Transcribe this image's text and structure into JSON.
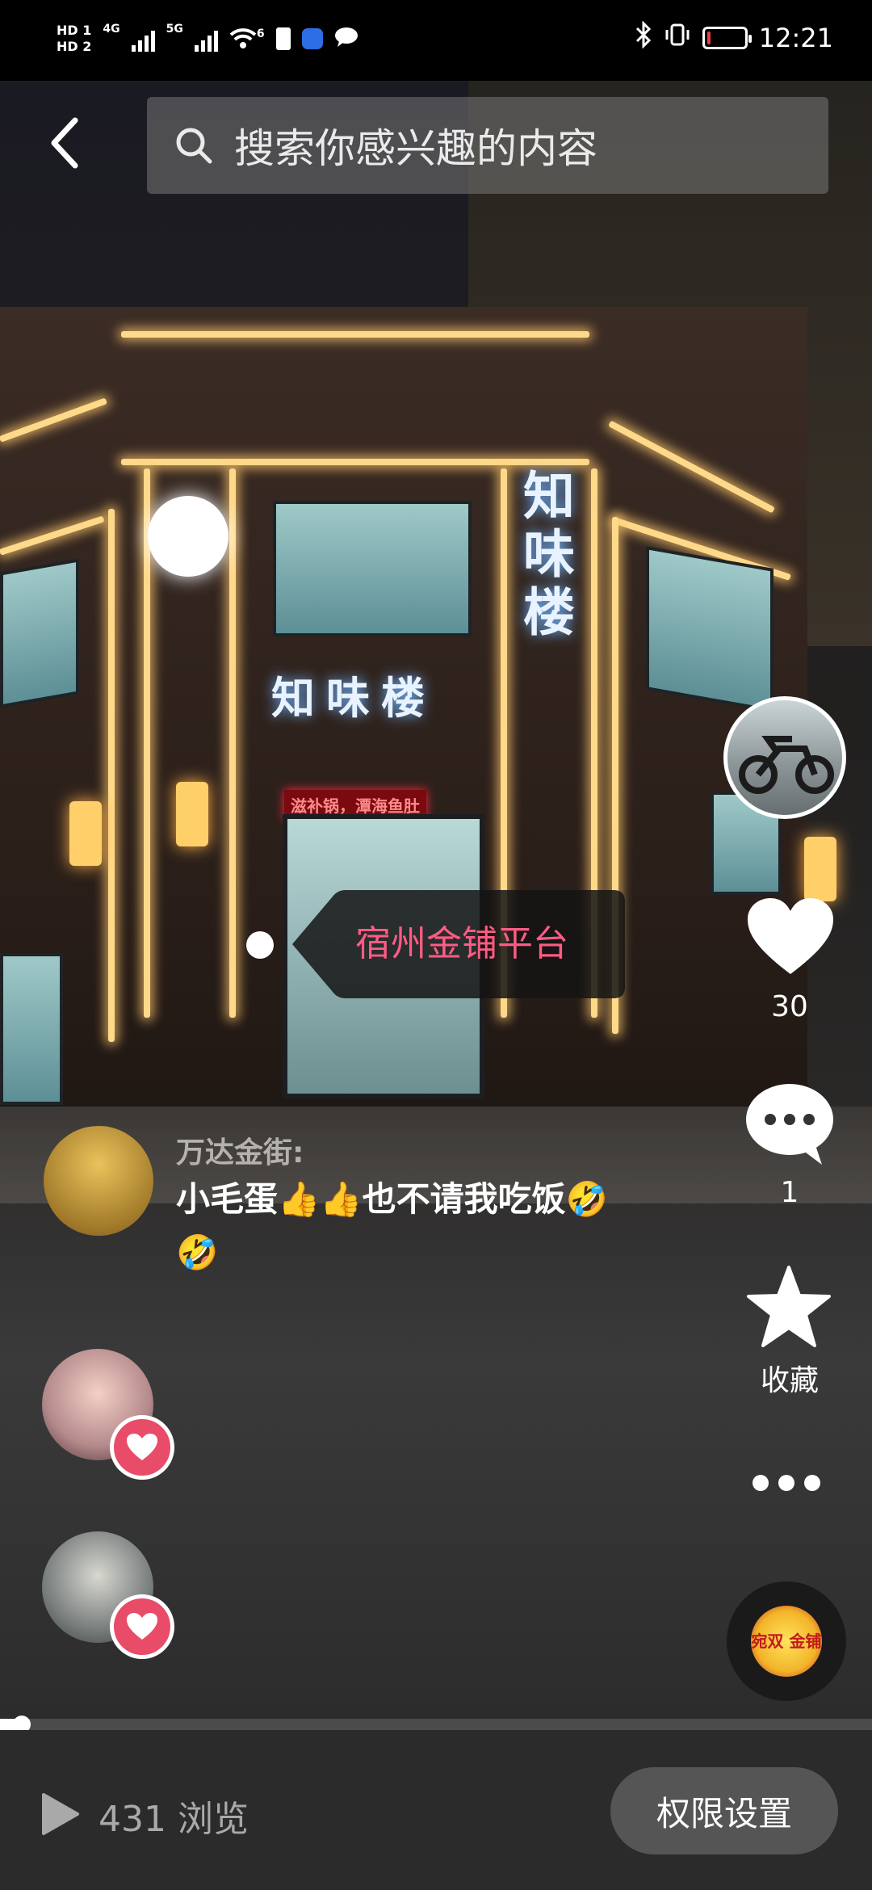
{
  "status_bar": {
    "left_labels": [
      "HD 1",
      "HD 2"
    ],
    "net1": "4G",
    "net2": "5G",
    "wifi_gen": "6",
    "time": "12:21",
    "battery_level_percent": 10,
    "battery_color": "#e84040"
  },
  "header": {
    "back_icon": "chevron-left-icon",
    "search_placeholder": "搜索你感兴趣的内容",
    "search_icon": "search-icon"
  },
  "video": {
    "location_tag": "宿州金铺平台",
    "sign_vertical": "知味楼",
    "sign_horizontal": "知味楼",
    "sign_red": "滋补锅，潭海鱼肚"
  },
  "actions": {
    "like_count": "30",
    "comment_count": "1",
    "favorite_label": "收藏",
    "like_icon": "heart-icon",
    "comment_icon": "comment-bubble-icon",
    "favorite_icon": "star-icon",
    "more_icon": "more-dots-icon"
  },
  "music_disc": {
    "label": "宛双 金铺"
  },
  "comment": {
    "user": "万达金街:",
    "text": "小毛蛋👍👍也不请我吃饭🤣🤣"
  },
  "progress": {
    "played_fraction": 0.025
  },
  "bottom_bar": {
    "views": "431 浏览",
    "permission_button": "权限设置",
    "play_icon": "play-icon"
  },
  "colors": {
    "accent_pink": "#ff5b84",
    "heart_badge": "#e84c68",
    "bottom_bar": "#2b2b2b"
  }
}
